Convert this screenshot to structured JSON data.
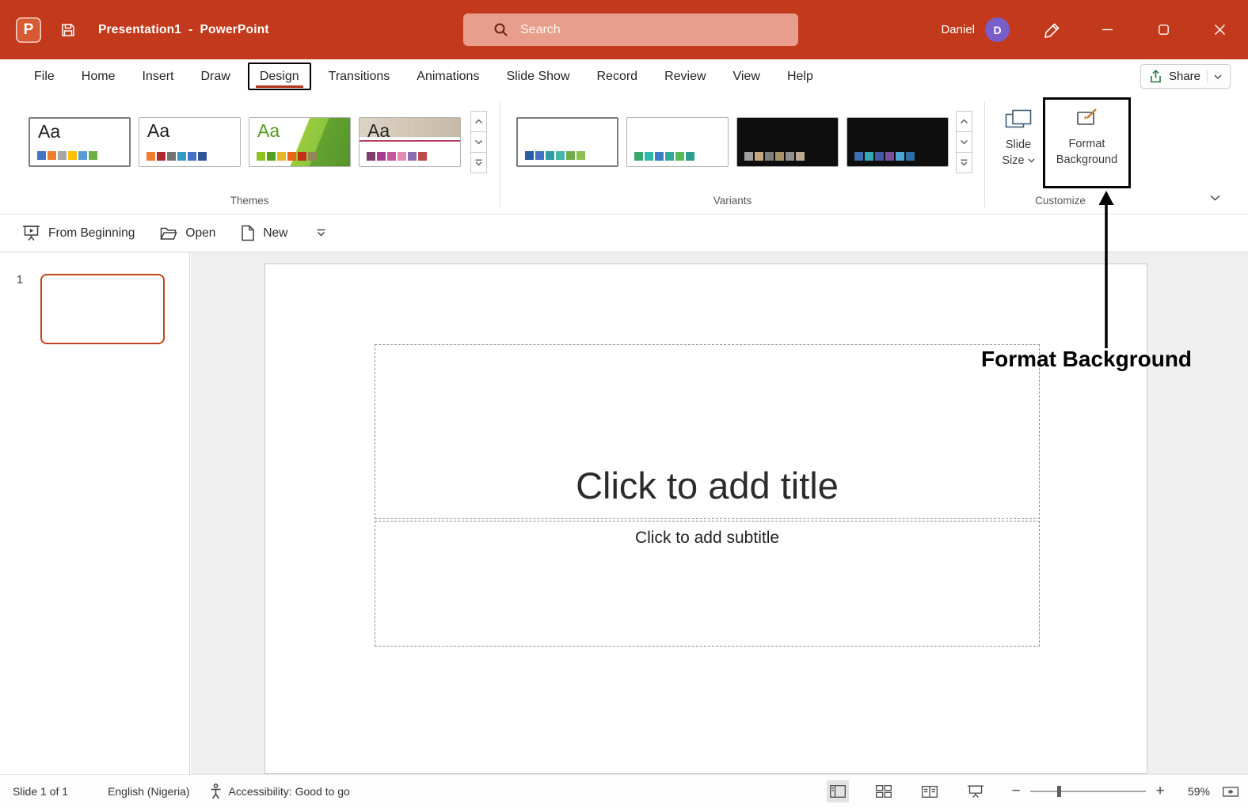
{
  "colors": {
    "titlebar_red": "#C2391B",
    "accent_red": "#C0451F",
    "tab_underline_red": "#B5331A",
    "avatar_purple": "#7A5EC8",
    "share_green": "#1E7A46",
    "annotation_black": "#000000",
    "canvas_gray": "#EFEFEF"
  },
  "titlebar": {
    "doc_name": "Presentation1",
    "separator": "-",
    "app_name": "PowerPoint",
    "search_placeholder": "Search",
    "user_name": "Daniel",
    "avatar_letter": "D"
  },
  "ribbon": {
    "tabs": [
      "File",
      "Home",
      "Insert",
      "Draw",
      "Design",
      "Transitions",
      "Animations",
      "Slide Show",
      "Record",
      "Review",
      "View",
      "Help"
    ],
    "active_tab": "Design",
    "share_label": "Share"
  },
  "themes_group": {
    "label": "Themes",
    "items": [
      {
        "aa": "Aa",
        "aa_color": "#1F1F1F",
        "selected": true,
        "swatches": [
          "#4472C4",
          "#ED7D31",
          "#A5A5A5",
          "#FFC000",
          "#5B9BD5",
          "#70AD47"
        ]
      },
      {
        "aa": "Aa",
        "aa_color": "#1F1F1F",
        "selected": false,
        "swatches": [
          "#ED7D31",
          "#B02B2F",
          "#747474",
          "#2E9BC0",
          "#4472C4",
          "#2F5597"
        ]
      },
      {
        "aa": "Aa",
        "aa_color": "#56971E",
        "selected": false,
        "swatches": [
          "#90C226",
          "#54A021",
          "#E6B91E",
          "#E76618",
          "#C42F1A",
          "#918655"
        ]
      },
      {
        "aa": "Aa",
        "aa_color": "#262626",
        "selected": false,
        "swatches": [
          "#7D3C6A",
          "#A43D8F",
          "#C6579A",
          "#E08BB4",
          "#8C6BAE",
          "#BE4B48"
        ]
      }
    ]
  },
  "variants_group": {
    "label": "Variants",
    "items": [
      {
        "bg": "#FFFFFF",
        "selected": true,
        "swatches": [
          "#2A5CAA",
          "#4472C4",
          "#2E9BA6",
          "#45B5AA",
          "#70AD47",
          "#8CC152"
        ]
      },
      {
        "bg": "#FFFFFF",
        "selected": false,
        "swatches": [
          "#37A76F",
          "#2FB8AC",
          "#3E7DCC",
          "#35A89A",
          "#58B957",
          "#2D9C93"
        ]
      },
      {
        "bg": "#0E0E0E",
        "selected": false,
        "swatches": [
          "#9E9E9E",
          "#C3A87E",
          "#7F7F7F",
          "#A8906B",
          "#8F8F8F",
          "#BFA98F"
        ]
      },
      {
        "bg": "#0E0E0E",
        "selected": false,
        "swatches": [
          "#3E6DB5",
          "#36A5B5",
          "#4458A8",
          "#7A4FA0",
          "#4BA3D6",
          "#2E6DA4"
        ]
      }
    ]
  },
  "customize_group": {
    "label": "Customize",
    "slide_size": {
      "line1": "Slide",
      "line2": "Size"
    },
    "format_background": {
      "line1": "Format",
      "line2": "Background"
    }
  },
  "quick_toolbar": {
    "from_beginning": "From Beginning",
    "open": "Open",
    "new": "New"
  },
  "slides_panel": {
    "slide_number": "1"
  },
  "slide": {
    "title_placeholder": "Click to add title",
    "subtitle_placeholder": "Click to add subtitle"
  },
  "annotation": {
    "label": "Format Background"
  },
  "statusbar": {
    "slide_info": "Slide 1 of 1",
    "language": "English (Nigeria)",
    "accessibility": "Accessibility: Good to go",
    "zoom_percent": "59%"
  }
}
